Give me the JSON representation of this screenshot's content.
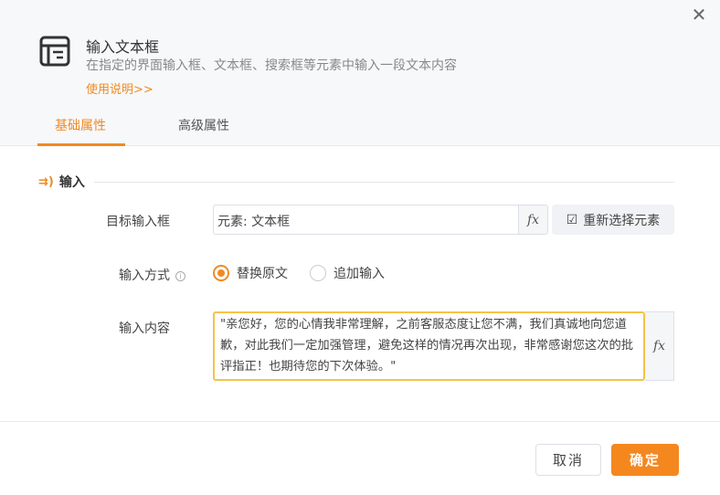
{
  "header": {
    "title": "输入文本框",
    "description": "在指定的界面输入框、文本框、搜索框等元素中输入一段文本内容",
    "help_link": "使用说明>>"
  },
  "tabs": [
    {
      "label": "基础属性",
      "active": true
    },
    {
      "label": "高级属性",
      "active": false
    }
  ],
  "section": {
    "title": "输入"
  },
  "form": {
    "target_label": "目标输入框",
    "target_value": "元素: 文本框",
    "fx": "fx",
    "reselect_label": "重新选择元素",
    "mode_label": "输入方式",
    "mode_options": [
      {
        "label": "替换原文",
        "selected": true
      },
      {
        "label": "追加输入",
        "selected": false
      }
    ],
    "content_label": "输入内容",
    "content_value": "\"亲您好，您的心情我非常理解，之前客服态度让您不满，我们真诚地向您道歉，对此我们一定加强管理，避免这样的情况再次出现，非常感谢您这次的批评指正！也期待您的下次体验。\""
  },
  "footer": {
    "cancel": "取消",
    "confirm": "确定"
  },
  "colors": {
    "accent": "#f08a24",
    "focus_border": "#f5c24a"
  }
}
